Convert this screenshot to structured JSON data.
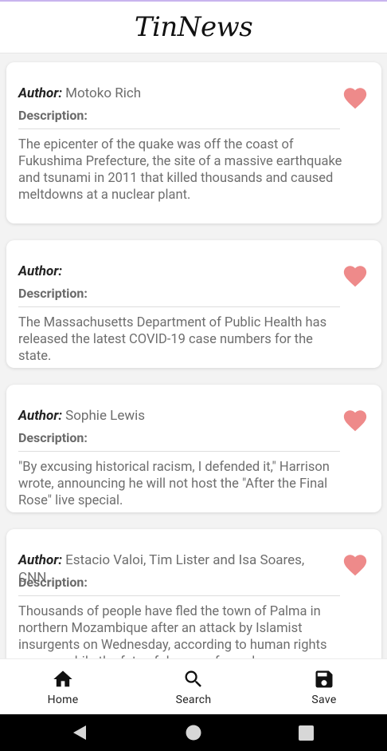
{
  "app": {
    "title": "TinNews"
  },
  "labels": {
    "author": "Author:",
    "description": "Description:"
  },
  "articles": [
    {
      "author": "Motoko Rich",
      "description": "The epicenter of the quake was off the coast of Fukushima Prefecture, the site of a massive earthquake and tsunami in 2011 that killed thousands and caused meltdowns at a nuclear plant."
    },
    {
      "author": "",
      "description": "The Massachusetts Department of Public Health has released the latest COVID-19 case numbers for the state."
    },
    {
      "author": "Sophie Lewis",
      "description": "\"By excusing historical racism, I defended it,\" Harrison wrote, announcing he will not host the \"After the Final Rose\" live special."
    },
    {
      "author": "Estacio Valoi, Tim Lister and Isa Soares, CNN",
      "description": "Thousands of people have fled the town of Palma in northern Mozambique after an attack by Islamist insurgents on Wednesday, according to human rights groups, while the fate of dozens of people"
    }
  ],
  "bottom_nav": {
    "home": "Home",
    "search": "Search",
    "save": "Save"
  },
  "colors": {
    "heart": "#ee8a8a",
    "accent_line": "#c8b4ee"
  },
  "icons": {
    "favorite": "heart-icon",
    "home": "home-icon",
    "search": "search-icon",
    "save": "save-icon",
    "back": "back-icon",
    "home_system": "home-circle-icon",
    "recents": "recents-icon"
  }
}
